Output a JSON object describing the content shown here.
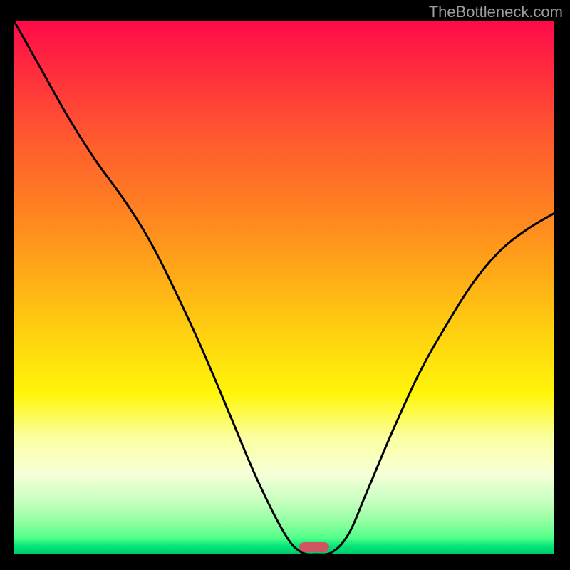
{
  "watermark": "TheBottleneck.com",
  "marker": {
    "x_frac": 0.555,
    "y_frac": 0.987
  },
  "chart_data": {
    "type": "line",
    "title": "",
    "xlabel": "",
    "ylabel": "",
    "xlim": [
      0,
      1
    ],
    "ylim": [
      0,
      1
    ],
    "legend": false,
    "grid": false,
    "background": "rainbow-vertical",
    "series": [
      {
        "name": "curve",
        "color": "#000000",
        "x": [
          0.0,
          0.05,
          0.1,
          0.15,
          0.2,
          0.25,
          0.3,
          0.35,
          0.4,
          0.45,
          0.5,
          0.53,
          0.56,
          0.59,
          0.62,
          0.65,
          0.7,
          0.75,
          0.8,
          0.85,
          0.9,
          0.95,
          1.0
        ],
        "y": [
          1.0,
          0.91,
          0.82,
          0.74,
          0.67,
          0.59,
          0.49,
          0.38,
          0.26,
          0.14,
          0.04,
          0.005,
          0.0,
          0.005,
          0.04,
          0.11,
          0.23,
          0.34,
          0.43,
          0.51,
          0.57,
          0.61,
          0.64
        ]
      }
    ],
    "annotations": [
      {
        "type": "pill",
        "x": 0.555,
        "y": 0.013,
        "color": "#cf5660"
      }
    ]
  }
}
